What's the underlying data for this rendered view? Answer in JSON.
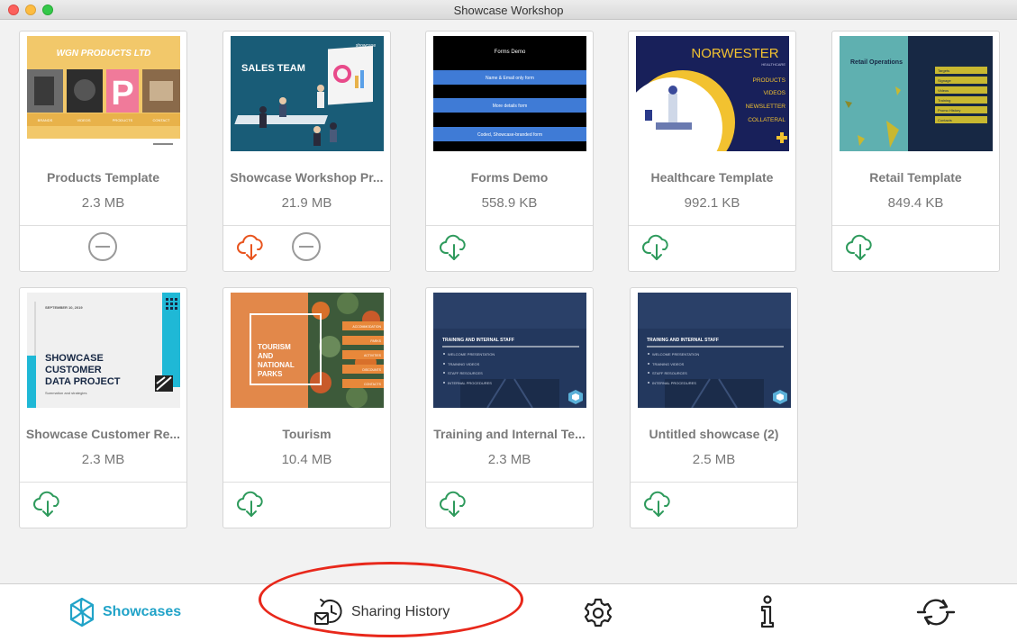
{
  "window": {
    "title": "Showcase Workshop"
  },
  "cards": [
    {
      "name": "Products Template",
      "size": "2.3 MB",
      "actions": [
        "remove"
      ]
    },
    {
      "name": "Showcase Workshop Pr...",
      "size": "21.9 MB",
      "actions": [
        "download-orange",
        "remove"
      ]
    },
    {
      "name": "Forms Demo",
      "size": "558.9 KB",
      "actions": [
        "download"
      ]
    },
    {
      "name": "Healthcare Template",
      "size": "992.1 KB",
      "actions": [
        "download"
      ]
    },
    {
      "name": "Retail Template",
      "size": "849.4 KB",
      "actions": [
        "download"
      ]
    },
    {
      "name": "Showcase Customer Re...",
      "size": "2.3 MB",
      "actions": [
        "download"
      ]
    },
    {
      "name": "Tourism",
      "size": "10.4 MB",
      "actions": [
        "download"
      ]
    },
    {
      "name": "Training and Internal Te...",
      "size": "2.3 MB",
      "actions": [
        "download"
      ]
    },
    {
      "name": "Untitled showcase (2)",
      "size": "2.5 MB",
      "actions": [
        "download"
      ]
    }
  ],
  "thumbs": {
    "products": {
      "title": "WGN PRODUCTS LTD",
      "tabs": [
        "BRANDS",
        "VIDEOS",
        "PRODUCTS",
        "CONTACT"
      ]
    },
    "sales": {
      "title": "SALES TEAM",
      "logo": "showcase"
    },
    "forms": {
      "title": "Forms Demo",
      "items": [
        "Name & Email only form",
        "More details form",
        "Coded, Showcase-branded form"
      ]
    },
    "health": {
      "title": "NORWESTER",
      "subtitle": "HEALTHCARE",
      "items": [
        "PRODUCTS",
        "VIDEOS",
        "NEWSLETTER",
        "COLLATERAL"
      ]
    },
    "retail": {
      "title": "Retail Operations",
      "items": [
        "Targets",
        "Signage",
        "Videos",
        "Training",
        "Promo History",
        "Contacts"
      ]
    },
    "customer": {
      "date": "SEPTEMBER 10, 2019",
      "title": "SHOWCASE CUSTOMER DATA PROJECT",
      "subtitle": "Summation and strategies"
    },
    "tourism": {
      "title": "TOURISM AND NATIONAL PARKS",
      "items": [
        "ACCOMMODATION",
        "PARKS",
        "ACTIVITIES",
        "DISCOUNTS",
        "CONTACTS"
      ]
    },
    "training": {
      "title": "TRAINING AND INTERNAL STAFF",
      "items": [
        "WELCOME PRESENTATION",
        "TRAINING VIDEOS",
        "STAFF RESOURCES",
        "INTERNAL PROCEDURES"
      ]
    }
  },
  "nav": {
    "showcases": "Showcases",
    "sharing_history": "Sharing History"
  },
  "colors": {
    "accent": "#21a3c8",
    "download": "#2e9a5c",
    "download_orange": "#e8541e",
    "remove": "#9a9a9a",
    "highlight": "#e8281b"
  },
  "icons": {
    "showcases": "showcase-logo-icon",
    "sharing_history": "sharing-history-icon",
    "settings": "gear-icon",
    "info": "info-icon",
    "sync": "sync-icon"
  }
}
